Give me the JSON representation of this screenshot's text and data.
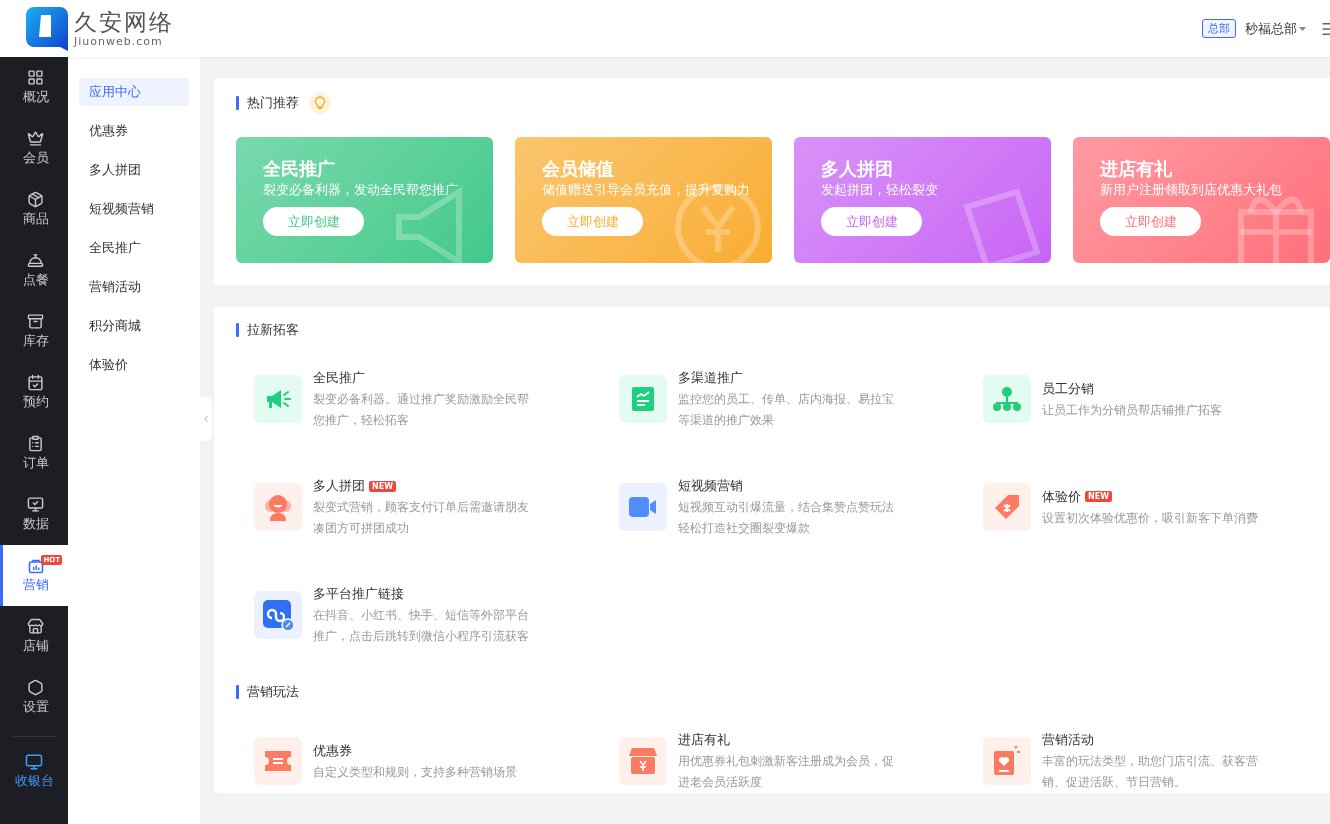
{
  "header": {
    "logo_title": "久安网络",
    "logo_subtitle": "Jiuonweb.com",
    "org_badge": "总部",
    "store": "秒福总部"
  },
  "nav": [
    {
      "label": "概况",
      "selected": false
    },
    {
      "label": "会员",
      "selected": false
    },
    {
      "label": "商品",
      "selected": false
    },
    {
      "label": "点餐",
      "selected": false
    },
    {
      "label": "库存",
      "selected": false
    },
    {
      "label": "预约",
      "selected": false
    },
    {
      "label": "订单",
      "selected": false
    },
    {
      "label": "数据",
      "selected": false
    },
    {
      "label": "营销",
      "selected": true,
      "badge": "HOT"
    },
    {
      "label": "店铺",
      "selected": false
    },
    {
      "label": "设置",
      "selected": false
    }
  ],
  "cashier": {
    "label": "收银台"
  },
  "subnav": [
    {
      "label": "应用中心",
      "selected": true
    },
    {
      "label": "优惠券",
      "selected": false
    },
    {
      "label": "多人拼团",
      "selected": false
    },
    {
      "label": "短视频营销",
      "selected": false
    },
    {
      "label": "全民推广",
      "selected": false
    },
    {
      "label": "营销活动",
      "selected": false
    },
    {
      "label": "积分商城",
      "selected": false
    },
    {
      "label": "体验价",
      "selected": false
    }
  ],
  "hot": {
    "title": "热门推荐",
    "cards": [
      {
        "title": "全民推广",
        "desc": "裂变必备利器，发动全民帮您推广",
        "button": "立即创建",
        "color": "#3fc98a",
        "kind": "megaphone"
      },
      {
        "title": "会员储值",
        "desc": "储值赠送引导会员充值，提升复购力",
        "button": "立即创建",
        "color": "#f9ad2f",
        "kind": "coin"
      },
      {
        "title": "多人拼团",
        "desc": "发起拼团，轻松裂变",
        "button": "立即创建",
        "color": "#c864f5",
        "kind": "tag"
      },
      {
        "title": "进店有礼",
        "desc": "新用户注册领取到店优惠大礼包",
        "button": "立即创建",
        "color": "#ff6f7a",
        "kind": "gift"
      }
    ]
  },
  "sections": [
    {
      "title": "拉新拓客",
      "items": [
        {
          "title": "全民推广",
          "desc": "裂变必备利器。通过推广奖励激励全民帮您推广，轻松拓客",
          "kind": "megaphone"
        },
        {
          "title": "多渠道推广",
          "desc": "监控您的员工、传单、店内海报、易拉宝等渠道的推广效果",
          "kind": "report"
        },
        {
          "title": "员工分销",
          "desc": "让员工作为分销员帮店铺推广拓客",
          "kind": "tree"
        },
        {
          "title": "多人拼团",
          "desc": "裂变式营销，顾客支付订单后需邀请朋友凑团方可拼团成功",
          "kind": "person",
          "badge": "NEW"
        },
        {
          "title": "短视频营销",
          "desc": "短视频互动引爆流量，结合集赞点赞玩法轻松打造社交圈裂变爆款",
          "kind": "video"
        },
        {
          "title": "体验价",
          "desc": "设置初次体验优惠价，吸引新客下单消费",
          "kind": "pricetag",
          "badge": "NEW"
        },
        {
          "title": "多平台推广链接",
          "desc": "在抖音、小红书、快手、短信等外部平台推广，点击后跳转到微信小程序引流获客",
          "kind": "link"
        }
      ]
    },
    {
      "title": "营销玩法",
      "items": [
        {
          "title": "优惠券",
          "desc": "自定义类型和规则，支持多种营销场景",
          "kind": "ticket"
        },
        {
          "title": "进店有礼",
          "desc": "用优惠券礼包刺激新客注册成为会员，促进老会员活跃度",
          "kind": "shop"
        },
        {
          "title": "营销活动",
          "desc": "丰富的玩法类型，助您门店引流、获客营销、促进活跃、节日营销。",
          "kind": "tablet"
        }
      ]
    }
  ]
}
